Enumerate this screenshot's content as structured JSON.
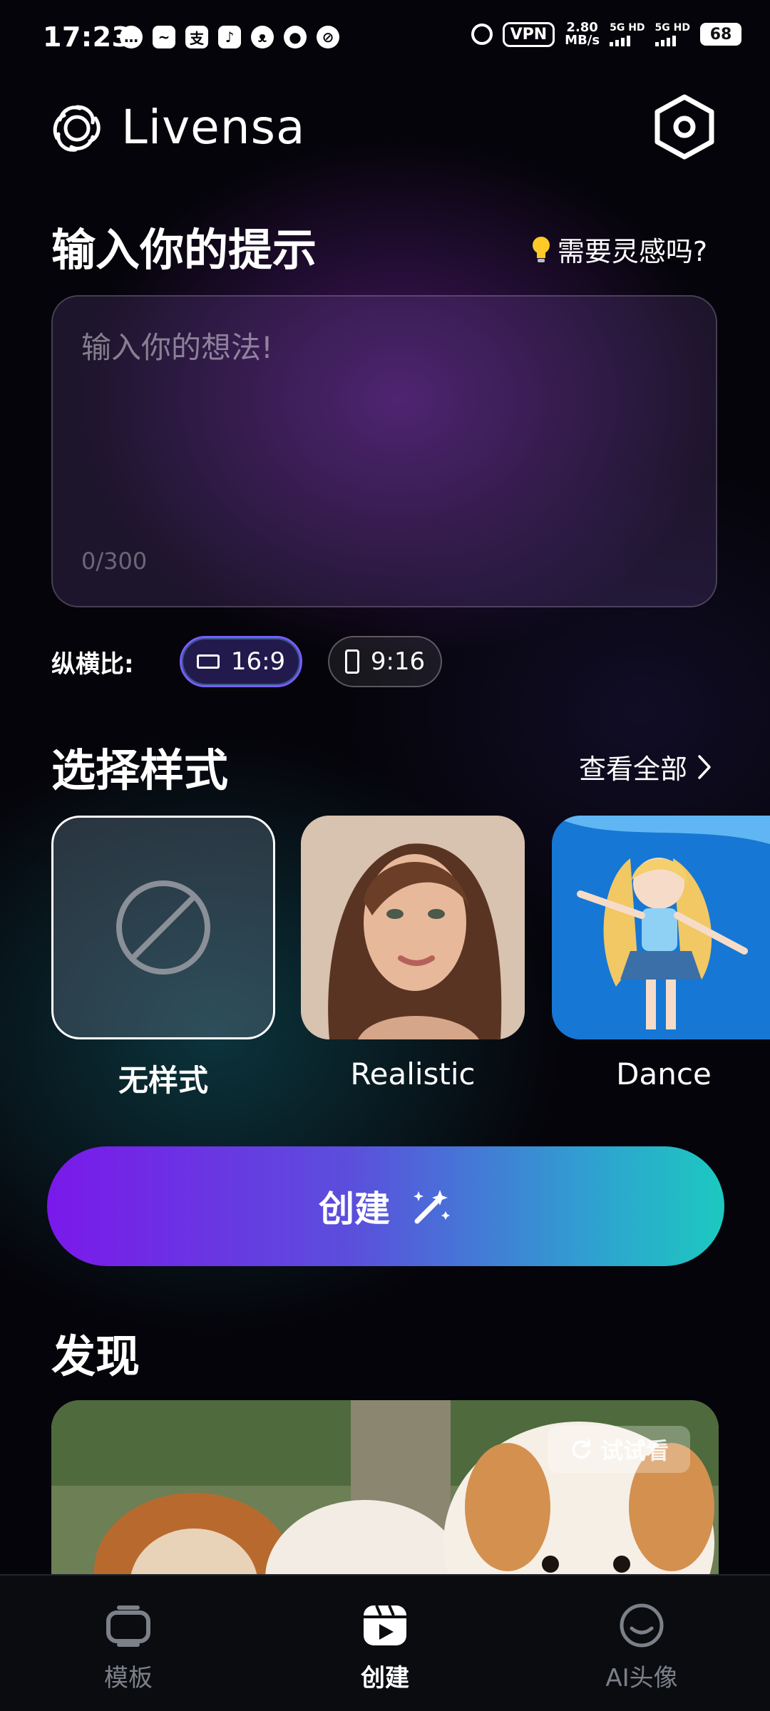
{
  "status_bar": {
    "time": "17:23",
    "vpn": "VPN",
    "net_speed_value": "2.80",
    "net_speed_unit": "MB/s",
    "sim1": "5G HD",
    "sim2": "5G HD",
    "battery": "68",
    "app_icons": [
      "message-icon",
      "whale-app-icon",
      "alipay-icon",
      "tiktok-icon",
      "bull-app-icon",
      "qq-icon",
      "compass-icon"
    ]
  },
  "header": {
    "app_name": "Livensa"
  },
  "prompt_section": {
    "title": "输入你的提示",
    "inspiration_link": "需要灵感吗?",
    "placeholder": "输入你的想法!",
    "counter": "0/300"
  },
  "aspect_ratio": {
    "label": "纵横比:",
    "options": [
      {
        "label": "16:9",
        "selected": true
      },
      {
        "label": "9:16",
        "selected": false
      }
    ]
  },
  "styles_section": {
    "title": "选择样式",
    "see_all": "查看全部",
    "items": [
      {
        "label": "无样式",
        "selected": true
      },
      {
        "label": "Realistic",
        "selected": false
      },
      {
        "label": "Dance",
        "selected": false
      }
    ]
  },
  "create_button": {
    "label": "创建"
  },
  "discover_section": {
    "title": "发现",
    "try_button": "试试看"
  },
  "bottom_nav": {
    "items": [
      {
        "label": "模板",
        "icon": "template-icon",
        "active": false
      },
      {
        "label": "创建",
        "icon": "create-play-icon",
        "active": true
      },
      {
        "label": "AI头像",
        "icon": "ai-avatar-icon",
        "active": false
      }
    ]
  },
  "colors": {
    "accent_purple": "#7a19ea",
    "accent_teal": "#1cc9c0",
    "background": "#05040a"
  }
}
